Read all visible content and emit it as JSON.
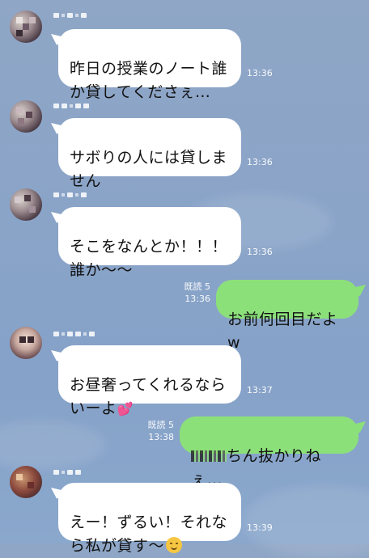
{
  "colors": {
    "incoming_bubble": "#ffffff",
    "outgoing_bubble": "#8ce07a",
    "background": "#8aa4c8"
  },
  "messages": [
    {
      "direction": "in",
      "sender_name_redacted": true,
      "avatar_icon": "avatar-pixelated",
      "text": "昨日の授業のノート誰\nか貸してくださぇ…",
      "time": "13:36"
    },
    {
      "direction": "in",
      "sender_name_redacted": true,
      "avatar_icon": "avatar-pixelated",
      "text": "サボりの人には貸しま\nせん",
      "time": "13:36"
    },
    {
      "direction": "in",
      "sender_name_redacted": true,
      "avatar_icon": "avatar-pixelated",
      "text": "そこをなんとか！！！\n誰か〜〜",
      "time": "13:36"
    },
    {
      "direction": "out",
      "read_label": "既読 5",
      "text": "お前何回目だよw",
      "time": "13:36"
    },
    {
      "direction": "in",
      "sender_name_redacted": true,
      "avatar_icon": "avatar-pixelated",
      "text": "お昼奢ってくれるなら\nいーよ",
      "emoji": "two-hearts-icon",
      "time": "13:37"
    },
    {
      "direction": "out",
      "read_label": "既読 5",
      "text": "ちん抜かりねぇ…",
      "redacted_prefix": true,
      "time": "13:38"
    },
    {
      "direction": "in",
      "sender_name_redacted": true,
      "avatar_icon": "avatar-pixelated",
      "text": "えー！ずるい！それな\nら私が貸す〜",
      "emoji": "smiling-face-icon",
      "time": "13:39"
    }
  ]
}
